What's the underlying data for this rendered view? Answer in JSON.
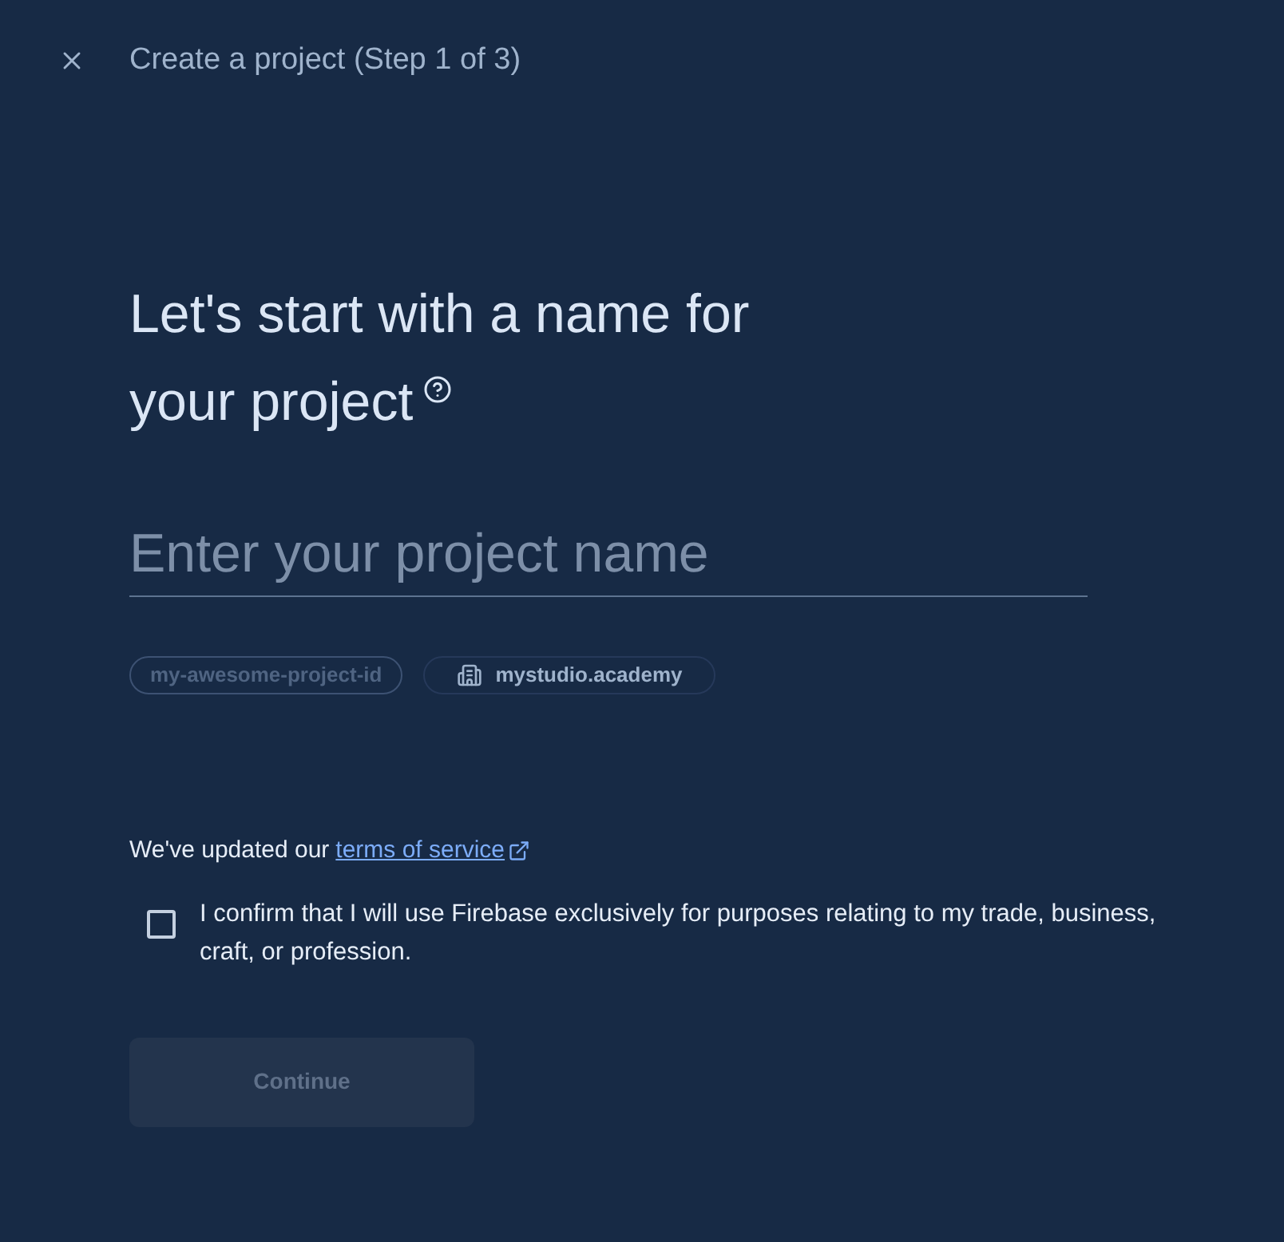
{
  "header": {
    "title": "Create a project (Step 1 of 3)"
  },
  "heading_lines": [
    "Let's start with a name for",
    "your project"
  ],
  "project_name": {
    "placeholder": "Enter your project name"
  },
  "chips": [
    {
      "kind": "id",
      "label": "my-awesome-project-id"
    },
    {
      "kind": "org",
      "label": "mystudio.academy"
    }
  ],
  "terms": {
    "text": "We've updated our",
    "link": "terms of service"
  },
  "confirm": {
    "checked": false,
    "label": "I confirm that I will use Firebase exclusively for purposes relating to my trade, business, craft, or profession."
  },
  "continue_button": {
    "label": "Continue",
    "disabled": true
  }
}
